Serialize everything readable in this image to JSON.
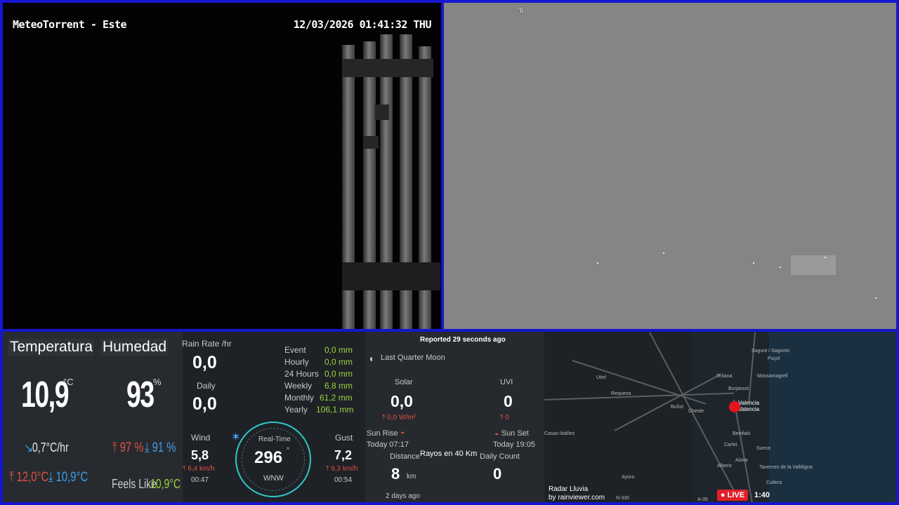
{
  "camera_left": {
    "title": "MeteoTorrent - Este",
    "timestamp": "12/03/2026 01:41:32 THU"
  },
  "camera_right": {
    "label": "'6"
  },
  "temperature": {
    "header": "Temperatura",
    "value": "10,9",
    "unit": "°C",
    "trend_icon": "trend-down-icon",
    "trend": "0,7",
    "trend_unit": "°C/hr",
    "high": "12,0",
    "high_unit": "°C",
    "low": "10,9",
    "low_unit": "°C"
  },
  "humidity": {
    "header": "Humedad",
    "value": "93",
    "unit": "%",
    "high": "97",
    "high_unit": "%",
    "low": "91",
    "low_unit": "%",
    "feels_like_label": "Feels Like",
    "feels_like": "10,9",
    "feels_like_unit": "°C"
  },
  "rain": {
    "rate_label": "Rain Rate /hr",
    "rate": "0,0",
    "daily_label": "Daily",
    "daily": "0,0",
    "rows": [
      {
        "label": "Event",
        "value": "0,0 mm"
      },
      {
        "label": "Hourly",
        "value": "0,0 mm"
      },
      {
        "label": "24 Hours",
        "value": "0,0 mm"
      },
      {
        "label": "Weekly",
        "value": "6,8 mm"
      },
      {
        "label": "Monthly",
        "value": "61,2 mm"
      },
      {
        "label": "Yearly",
        "value": "106,1 mm"
      }
    ]
  },
  "wind": {
    "label": "Wind",
    "value": "5,8",
    "max": "6,4 km/h",
    "time": "00:47",
    "gauge_label": "Real-Time",
    "direction": "296",
    "direction_unit": "°",
    "cardinal": "WNW",
    "gust_label": "Gust",
    "gust": "7,2",
    "gust_max": "9,3 km/h",
    "gust_time": "00:54"
  },
  "sky": {
    "reported": "Reported 29 seconds ago",
    "moon_icon": "moon-icon",
    "moon": "Last Quarter Moon",
    "solar_label": "Solar",
    "solar": "0,0",
    "solar_max": "0,0 W/m²",
    "uvi_label": "UVI",
    "uvi": "0",
    "uvi_max": "0",
    "sunrise_label": "Sun Rise",
    "sunrise": "Today 07:17",
    "sunset_label": "Sun Set",
    "sunset": "Today 19:05",
    "lightning_title": "Rayos en 40 Km",
    "distance_label": "Distance",
    "distance": "8",
    "distance_unit": "km",
    "daily_count_label": "Daily Count",
    "daily_count": "0",
    "last_strike": "2 days ago"
  },
  "radar": {
    "title": "Radar Lluvia",
    "credit": "by rainviewer.com",
    "live": "● LIVE",
    "time": "1:40",
    "cities": [
      "Sagunt / Sagunto",
      "Puçol",
      "l'Eliana",
      "Burjassot",
      "Massamagrell",
      "Utiel",
      "Requena",
      "Buñol",
      "Valencia",
      "Valencia",
      "Cheste",
      "Alzira",
      "Sueca",
      "Carlet",
      "Benifaió",
      "Ayora",
      "Alberic",
      "Tavernes de la Valldigna",
      "Cullera",
      "Casas-Ibáñez",
      "N-330",
      "A-35"
    ]
  }
}
